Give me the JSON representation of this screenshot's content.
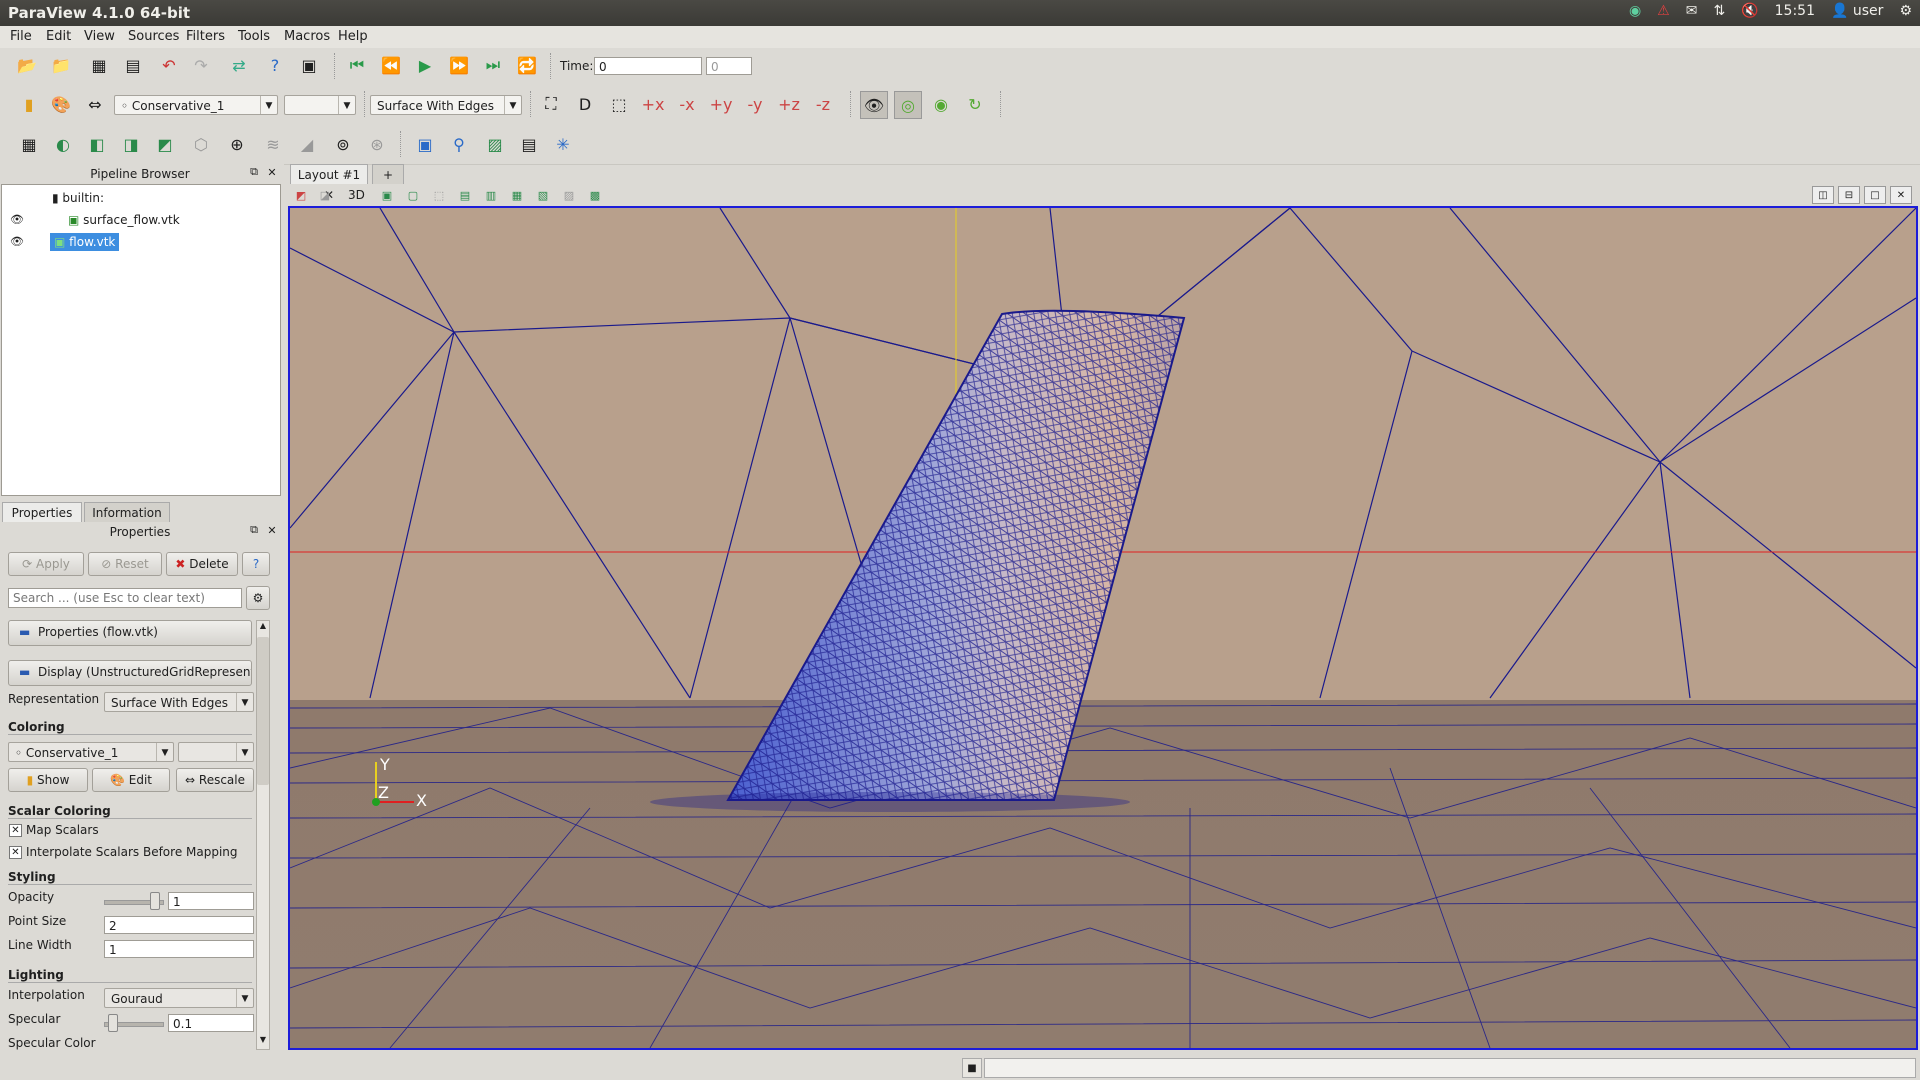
{
  "window": {
    "title": "ParaView 4.1.0 64-bit"
  },
  "tray": {
    "time": "15:51",
    "user": "user"
  },
  "menu": [
    "File",
    "Edit",
    "View",
    "Sources",
    "Filters",
    "Tools",
    "Macros",
    "Help"
  ],
  "time_toolbar": {
    "label": "Time:",
    "value": "0",
    "step": "0"
  },
  "color_toolbar": {
    "array": "Conservative_1",
    "component": "",
    "representation": "Surface With Edges"
  },
  "pipeline": {
    "title": "Pipeline Browser",
    "root": "builtin:",
    "items": [
      {
        "name": "surface_flow.vtk"
      },
      {
        "name": "flow.vtk"
      }
    ]
  },
  "tabs": {
    "properties": "Properties",
    "information": "Information"
  },
  "properties": {
    "title": "Properties",
    "apply": "Apply",
    "reset": "Reset",
    "delete": "Delete",
    "help": "?",
    "search_placeholder": "Search ... (use Esc to clear text)",
    "section_props": "Properties (flow.vtk)",
    "section_display": "Display (UnstructuredGridRepresenta",
    "representation_label": "Representation",
    "representation_value": "Surface With Edges",
    "coloring_title": "Coloring",
    "coloring_array": "Conservative_1",
    "coloring_component": "",
    "show": "Show",
    "edit": "Edit",
    "rescale": "Rescale",
    "scalar_title": "Scalar Coloring",
    "map_scalars": "Map Scalars",
    "interpolate": "Interpolate Scalars Before Mapping",
    "styling_title": "Styling",
    "opacity_label": "Opacity",
    "opacity_value": "1",
    "pointsize_label": "Point Size",
    "pointsize_value": "2",
    "linewidth_label": "Line Width",
    "linewidth_value": "1",
    "lighting_title": "Lighting",
    "interp_label": "Interpolation",
    "interp_value": "Gouraud",
    "specular_label": "Specular",
    "specular_value": "0.1",
    "specular_color_label": "Specular Color"
  },
  "layout": {
    "tab": "Layout #1",
    "add": "+",
    "mode3d": "3D"
  },
  "axes": {
    "y": "Y",
    "z": "Z",
    "x": "X"
  },
  "colors": {
    "accent": "#1c1cd9",
    "sky": "#b8a08c",
    "mesh": "#1a1a8c",
    "highlight": "#3d8ee0"
  }
}
